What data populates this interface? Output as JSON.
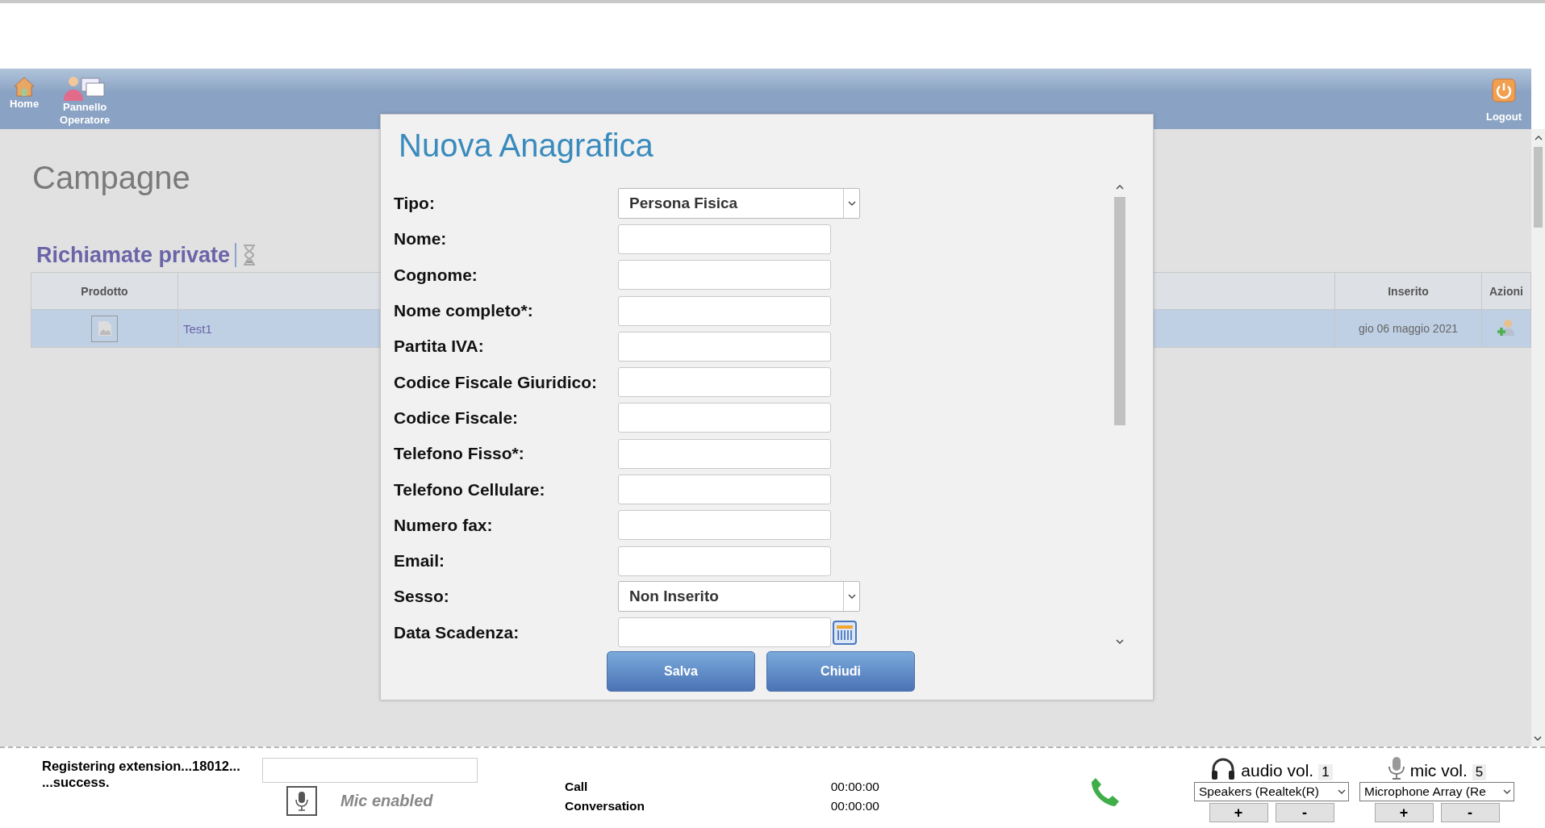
{
  "nav": {
    "items": [
      {
        "label": "Home",
        "kind": "home"
      },
      {
        "label": "Pannello Operatore",
        "kind": "operator"
      }
    ],
    "logout": "Logout"
  },
  "page_title": "Campagne",
  "section_title": "Richiamate private",
  "table": {
    "columns": [
      "Prodotto",
      "Inserito",
      "Azioni"
    ],
    "rows": [
      {
        "selected": true,
        "product_name": "Test1",
        "inserted": "gio 06 maggio 2021"
      }
    ]
  },
  "dialog": {
    "title": "Nuova Anagrafica",
    "fields": [
      {
        "label": "Tipo:",
        "kind": "select",
        "value": "Persona Fisica"
      },
      {
        "label": "Nome:",
        "kind": "text"
      },
      {
        "label": "Cognome:",
        "kind": "text"
      },
      {
        "label": "Nome completo*:",
        "kind": "text"
      },
      {
        "label": "Partita IVA:",
        "kind": "text"
      },
      {
        "label": "Codice Fiscale Giuridico:",
        "kind": "text"
      },
      {
        "label": "Codice Fiscale:",
        "kind": "text"
      },
      {
        "label": "Telefono Fisso*:",
        "kind": "text"
      },
      {
        "label": "Telefono Cellulare:",
        "kind": "text"
      },
      {
        "label": "Numero fax:",
        "kind": "text"
      },
      {
        "label": "Email:",
        "kind": "text"
      },
      {
        "label": "Sesso:",
        "kind": "select",
        "value": "Non Inserito"
      },
      {
        "label": "Data Scadenza:",
        "kind": "date"
      }
    ],
    "buttons": [
      "Salva",
      "Chiudi"
    ]
  },
  "softphone": {
    "status": [
      "Registering extension...18012...",
      "...success."
    ],
    "mic_status": "Mic enabled",
    "timers": [
      {
        "label": "Call",
        "value": "00:00:00"
      },
      {
        "label": "Conversation",
        "value": "00:00:00"
      }
    ],
    "volumes": [
      {
        "kind": "audio",
        "label": "audio vol.",
        "value": "1",
        "device": "Speakers (Realtek(R)",
        "buttons": [
          "+",
          "-"
        ]
      },
      {
        "kind": "mic",
        "label": "mic vol.",
        "value": "5",
        "device": "Microphone Array (Re",
        "buttons": [
          "+",
          "-"
        ]
      }
    ]
  }
}
